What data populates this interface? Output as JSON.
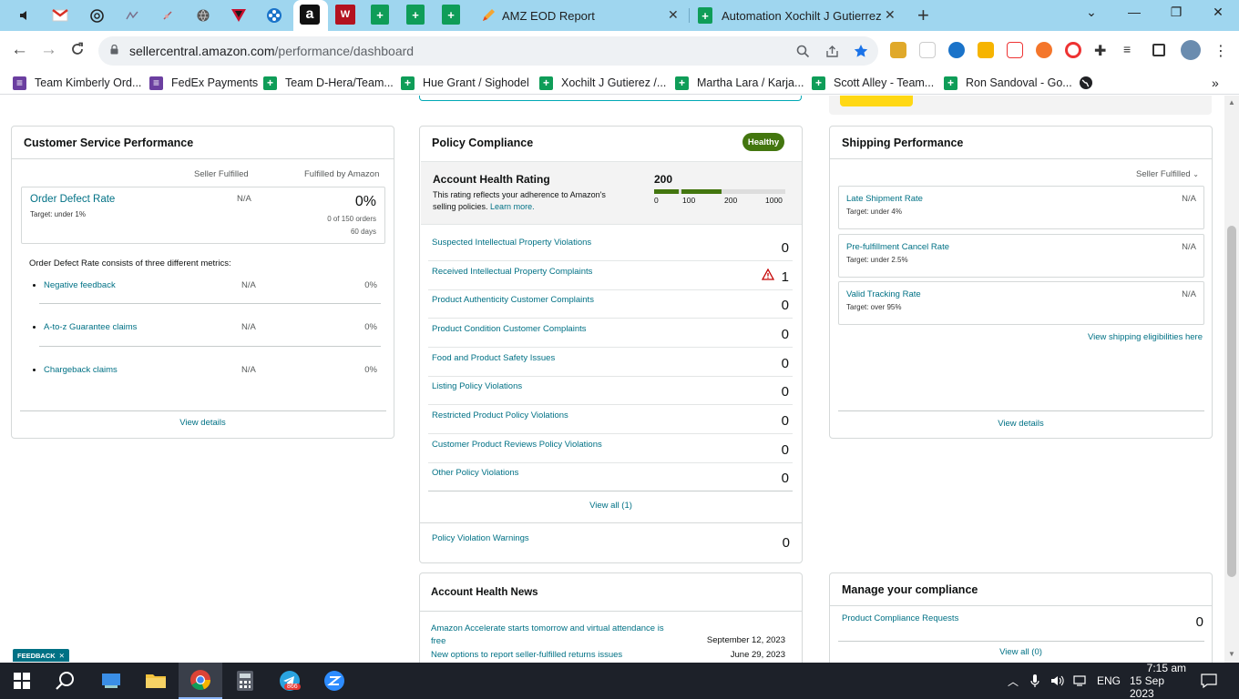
{
  "browser": {
    "tabs": [
      {
        "title": "AMZ EOD Report"
      },
      {
        "title": "Automation Xochilt J Gutierrez (C"
      }
    ],
    "url_host": "sellercentral.amazon.com",
    "url_path": "/performance/dashboard",
    "new_tab": "+"
  },
  "bookmarks": [
    {
      "label": "Team Kimberly Ord...",
      "icon": "purple"
    },
    {
      "label": "FedEx Payments",
      "icon": "purple"
    },
    {
      "label": "Team D-Hera/Team...",
      "icon": "green"
    },
    {
      "label": "Hue Grant / Sighodel",
      "icon": "green"
    },
    {
      "label": "Xochilt J Gutierez /...",
      "icon": "green"
    },
    {
      "label": "Martha Lara / Karja...",
      "icon": "green"
    },
    {
      "label": "Scott Alley - Team...",
      "icon": "green"
    },
    {
      "label": "Ron Sandoval - Go...",
      "icon": "green"
    }
  ],
  "csp": {
    "title": "Customer Service Performance",
    "col_seller": "Seller Fulfilled",
    "col_fba": "Fulfilled by Amazon",
    "odr": {
      "label": "Order Defect Rate",
      "target": "Target: under 1%",
      "seller": "N/A",
      "fba": "0%",
      "orders": "0 of 150 orders",
      "days": "60 days"
    },
    "consists": "Order Defect Rate consists of three different metrics:",
    "metrics": [
      {
        "label": "Negative feedback",
        "seller": "N/A",
        "fba": "0%"
      },
      {
        "label": "A-to-z Guarantee claims",
        "seller": "N/A",
        "fba": "0%"
      },
      {
        "label": "Chargeback claims",
        "seller": "N/A",
        "fba": "0%"
      }
    ],
    "view_details": "View details"
  },
  "policy": {
    "title": "Policy Compliance",
    "status": "Healthy",
    "ahr_title": "Account Health Rating",
    "ahr_desc_1": "This rating reflects your adherence to Amazon's",
    "ahr_desc_2": "selling policies.",
    "learn_more": "Learn more.",
    "score": "200",
    "scale": [
      "0",
      "100",
      "200",
      "1000"
    ],
    "rows": [
      {
        "label": "Suspected Intellectual Property Violations",
        "value": "0"
      },
      {
        "label": "Received Intellectual Property Complaints",
        "value": "1"
      },
      {
        "label": "Product Authenticity Customer Complaints",
        "value": "0"
      },
      {
        "label": "Product Condition Customer Complaints",
        "value": "0"
      },
      {
        "label": "Food and Product Safety Issues",
        "value": "0"
      },
      {
        "label": "Listing Policy Violations",
        "value": "0"
      },
      {
        "label": "Restricted Product Policy Violations",
        "value": "0"
      },
      {
        "label": "Customer Product Reviews Policy Violations",
        "value": "0"
      },
      {
        "label": "Other Policy Violations",
        "value": "0"
      }
    ],
    "view_all": "View all (1)",
    "warnings_label": "Policy Violation Warnings",
    "warnings_value": "0"
  },
  "shipping": {
    "title": "Shipping Performance",
    "filter": "Seller Fulfilled",
    "metrics": [
      {
        "label": "Late Shipment Rate",
        "target": "Target: under 4%",
        "value": "N/A"
      },
      {
        "label": "Pre-fulfillment Cancel Rate",
        "target": "Target: under 2.5%",
        "value": "N/A"
      },
      {
        "label": "Valid Tracking Rate",
        "target": "Target: over 95%",
        "value": "N/A"
      }
    ],
    "eligibilities": "View shipping eligibilities here",
    "view_details": "View details"
  },
  "news": {
    "title": "Account Health News",
    "items": [
      {
        "text": "Amazon Accelerate starts tomorrow and virtual attendance is free",
        "date": "September 12, 2023"
      },
      {
        "text": "New options to report seller-fulfilled returns issues",
        "date": "June 29, 2023"
      }
    ]
  },
  "compliance": {
    "title": "Manage your compliance",
    "requests_label": "Product Compliance Requests",
    "requests_value": "0",
    "view_all": "View all (0)"
  },
  "feedback": "FEEDBACK",
  "taskbar": {
    "telegram_badge": "866",
    "lang": "ENG",
    "time": "7:15 am",
    "date": "15 Sep 2023"
  },
  "colors": {
    "accent": "#43760f",
    "link": "#007185",
    "tabstrip": "#9fd6ef",
    "warning": "#c40000"
  }
}
